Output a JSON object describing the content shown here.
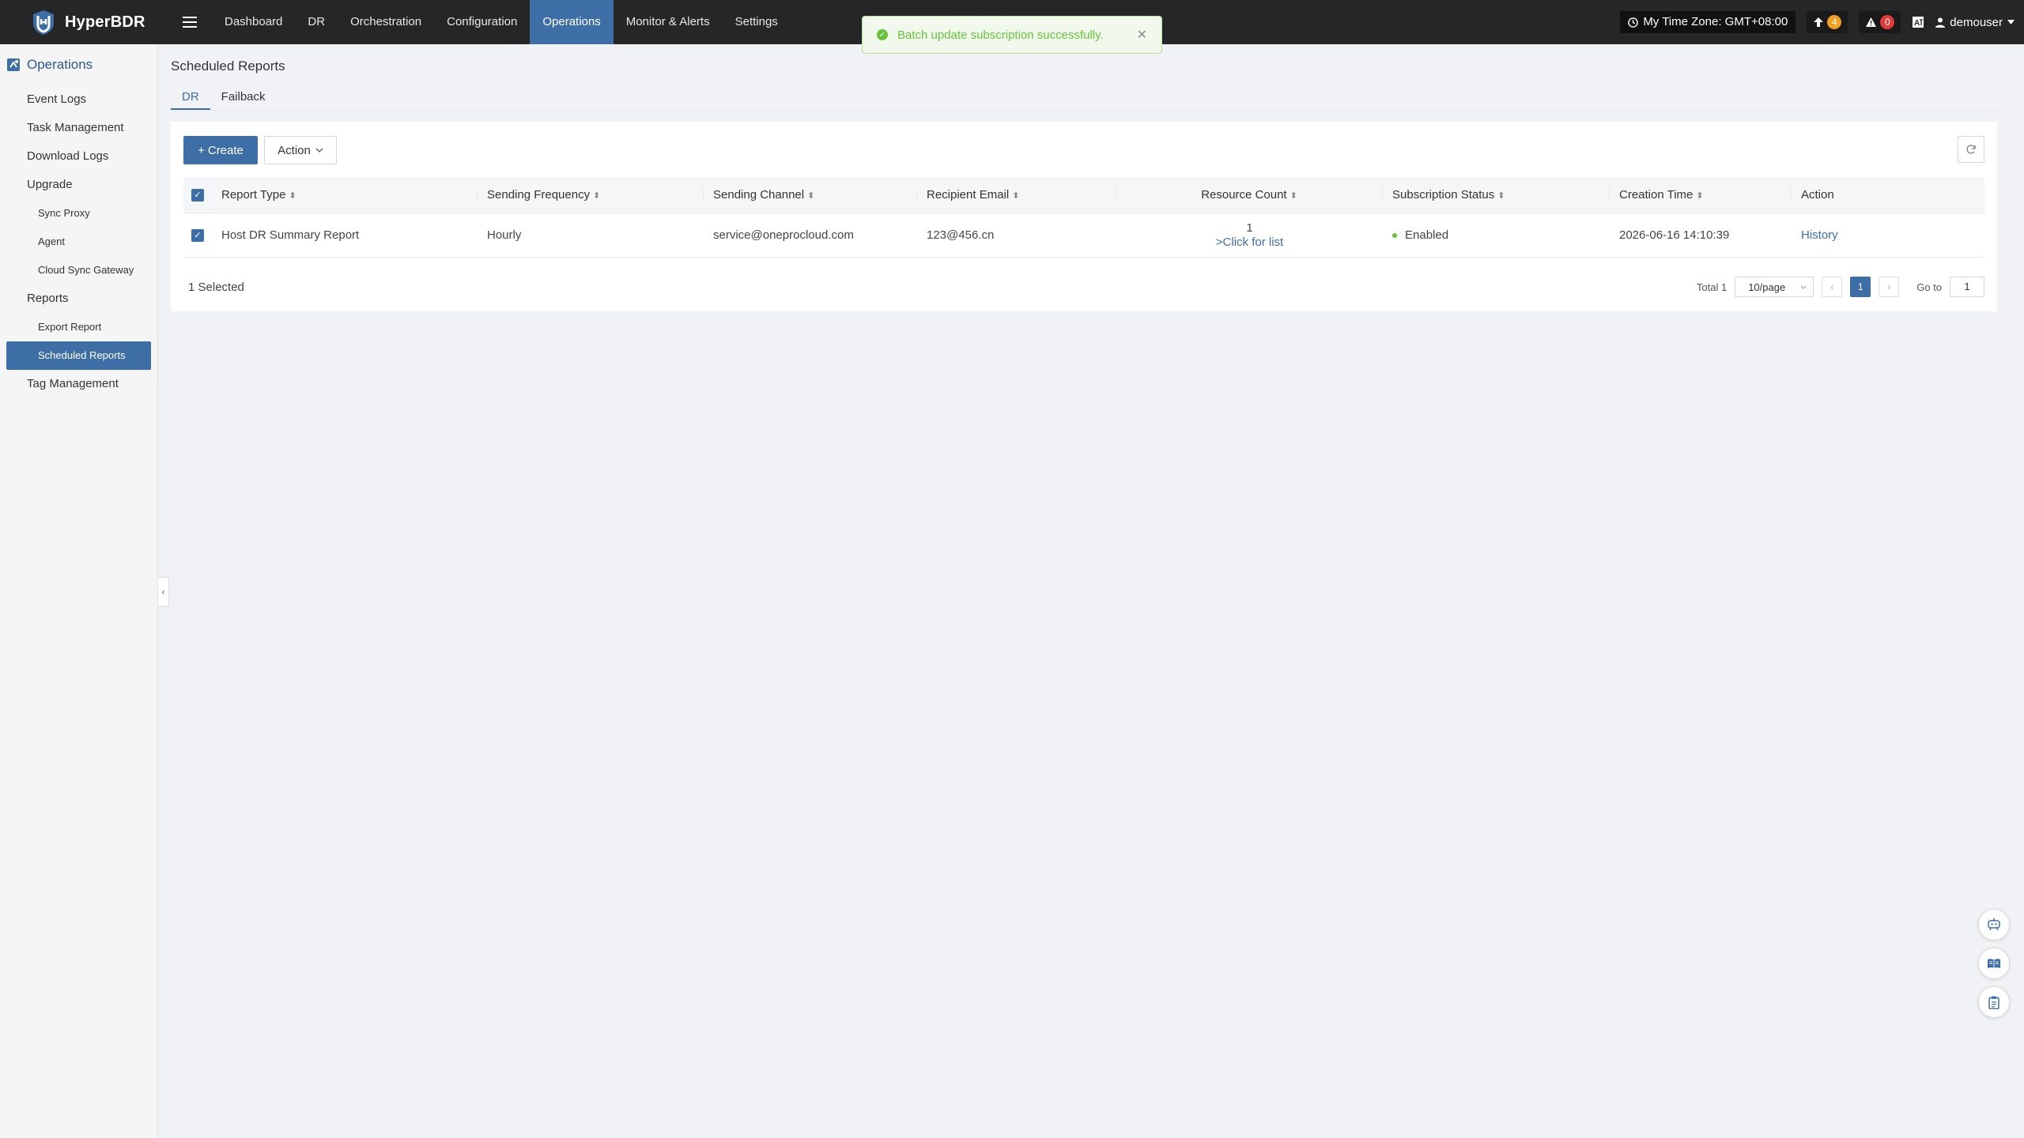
{
  "app": {
    "name": "HyperBDR"
  },
  "nav": {
    "items": [
      "Dashboard",
      "DR",
      "Orchestration",
      "Configuration",
      "Operations",
      "Monitor & Alerts",
      "Settings"
    ],
    "active_index": 4
  },
  "topbar": {
    "timezone": "My Time Zone: GMT+08:00",
    "upgrade_count": "4",
    "alert_count": "0",
    "user": "demouser"
  },
  "toast": {
    "message": "Batch update subscription successfully."
  },
  "sidebar": {
    "title": "Operations",
    "items": [
      {
        "label": "Event Logs",
        "level": 1
      },
      {
        "label": "Task Management",
        "level": 1
      },
      {
        "label": "Download Logs",
        "level": 1
      },
      {
        "label": "Upgrade",
        "level": 1
      },
      {
        "label": "Sync Proxy",
        "level": 2
      },
      {
        "label": "Agent",
        "level": 2
      },
      {
        "label": "Cloud Sync Gateway",
        "level": 2
      },
      {
        "label": "Reports",
        "level": 1
      },
      {
        "label": "Export Report",
        "level": 2
      },
      {
        "label": "Scheduled Reports",
        "level": 2,
        "active": true
      },
      {
        "label": "Tag Management",
        "level": 1
      }
    ]
  },
  "page": {
    "title": "Scheduled Reports",
    "tabs": [
      "DR",
      "Failback"
    ],
    "create_label": "Create",
    "action_label": "Action"
  },
  "table": {
    "headers": {
      "report_type": "Report Type",
      "frequency": "Sending Frequency",
      "channel": "Sending Channel",
      "email": "Recipient Email",
      "resource_count": "Resource Count",
      "status": "Subscription Status",
      "created": "Creation Time",
      "action": "Action"
    },
    "rows": [
      {
        "report_type": "Host DR Summary Report",
        "frequency": "Hourly",
        "channel": "service@oneprocloud.com",
        "email": "123@456.cn",
        "resource_count": "1",
        "resource_link": ">Click for list",
        "status": "Enabled",
        "created": "2026-06-16 14:10:39",
        "action": "History"
      }
    ]
  },
  "footer": {
    "selected": "1 Selected",
    "total": "Total 1",
    "page_size": "10/page",
    "current_page": "1",
    "goto_label": "Go to",
    "goto_value": "1"
  },
  "colors": {
    "accent": "#3d6ea5",
    "topbar": "#262626",
    "success": "#67c23a"
  }
}
